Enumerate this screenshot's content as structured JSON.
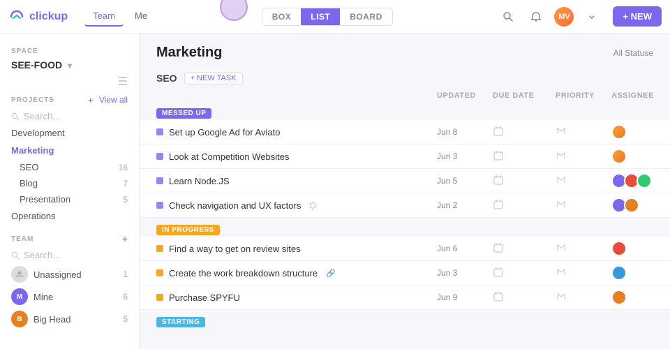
{
  "app": {
    "logo_text": "clickup",
    "nav": {
      "tabs": [
        {
          "label": "Team",
          "active": true
        },
        {
          "label": "Me",
          "active": false
        }
      ]
    },
    "view_tabs": [
      {
        "label": "BOX",
        "active": false
      },
      {
        "label": "LIST",
        "active": true
      },
      {
        "label": "BOARD",
        "active": false
      }
    ],
    "new_button": "+ NEW",
    "status_filter": "All Statuses"
  },
  "sidebar": {
    "space_label": "SPACE",
    "space_name": "SEE-FOOD",
    "projects_label": "PROJECTS",
    "projects_plus": "+",
    "view_all": "View all",
    "search_placeholder": "Search...",
    "project_items": [
      {
        "label": "Development",
        "active": false,
        "count": ""
      },
      {
        "label": "Marketing",
        "active": true,
        "count": ""
      },
      {
        "label": "SEO",
        "sub": true,
        "count": "16"
      },
      {
        "label": "Blog",
        "sub": true,
        "count": "7"
      },
      {
        "label": "Presentation",
        "sub": true,
        "count": "5"
      },
      {
        "label": "Operations",
        "active": false,
        "count": ""
      }
    ],
    "team_label": "TEAM",
    "team_plus": "+",
    "team_members": [
      {
        "name": "Unassigned",
        "count": "1",
        "color": "#ccc"
      },
      {
        "name": "Mine",
        "count": "6",
        "color": "#7b68ee"
      },
      {
        "name": "Big Head",
        "count": "5",
        "color": "#e67e22"
      }
    ]
  },
  "main": {
    "title": "Marketing",
    "seo_section": "SEO",
    "new_task_btn": "+ NEW TASK",
    "status_filter": "All Statuse",
    "table_headers": [
      "UPDATED",
      "DUE DATE",
      "PRIORITY",
      "ASSIGNEE"
    ],
    "sections": [
      {
        "badge": "MESSED UP",
        "badge_type": "messed-up",
        "tasks": [
          {
            "name": "Set up Google Ad for Aviato",
            "updated": "Jun 8",
            "dot": "purple",
            "has_meta": false
          },
          {
            "name": "Look at Competition Websites",
            "updated": "Jun 3",
            "dot": "purple",
            "has_meta": false
          },
          {
            "name": "Learn Node.JS",
            "updated": "Jun 5",
            "dot": "purple",
            "has_meta": false
          },
          {
            "name": "Check navigation and UX factors",
            "updated": "Jun 2",
            "dot": "purple",
            "has_meta": true
          }
        ]
      },
      {
        "badge": "IN PROGRESS",
        "badge_type": "in-progress",
        "tasks": [
          {
            "name": "Find a way to get on review sites",
            "updated": "Jun 6",
            "dot": "yellow",
            "has_meta": false
          },
          {
            "name": "Create the work breakdown structure",
            "updated": "Jun 3",
            "dot": "yellow",
            "has_meta": true
          },
          {
            "name": "Purchase SPYFU",
            "updated": "Jun 9",
            "dot": "yellow",
            "has_meta": false
          }
        ]
      },
      {
        "badge": "STARTING",
        "badge_type": "starting",
        "tasks": []
      }
    ]
  }
}
